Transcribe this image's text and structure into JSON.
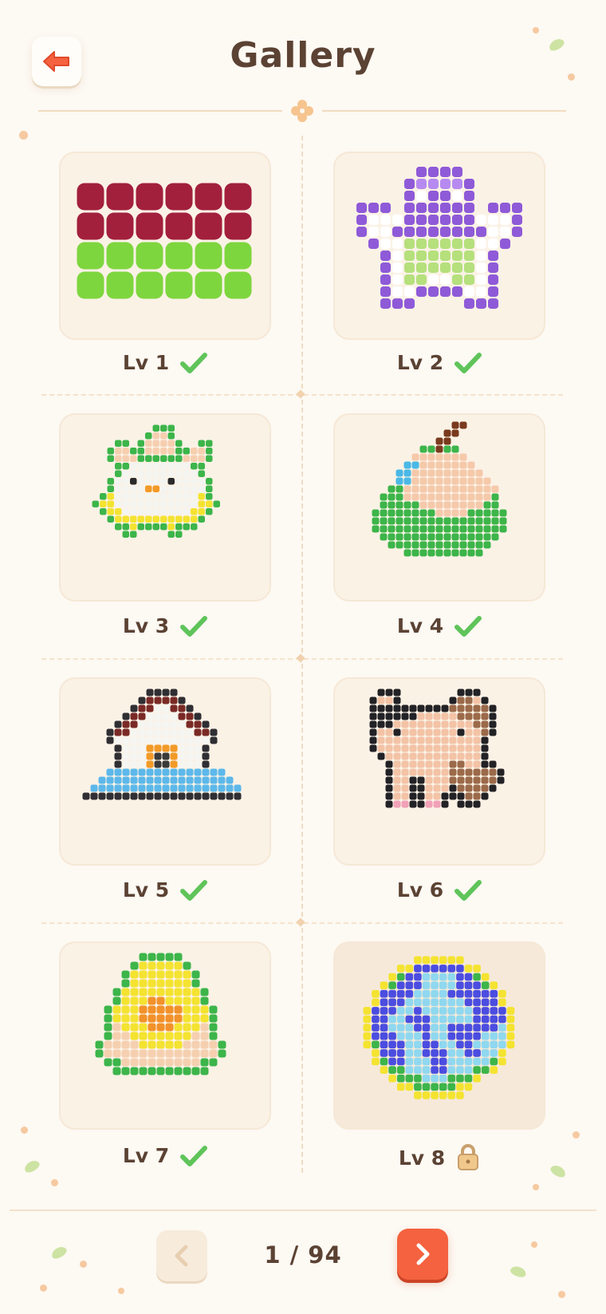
{
  "header": {
    "title": "Gallery"
  },
  "levels": [
    {
      "label": "Lv 1",
      "status": "completed"
    },
    {
      "label": "Lv 2",
      "status": "completed"
    },
    {
      "label": "Lv 3",
      "status": "completed"
    },
    {
      "label": "Lv 4",
      "status": "completed"
    },
    {
      "label": "Lv 5",
      "status": "completed"
    },
    {
      "label": "Lv 6",
      "status": "completed"
    },
    {
      "label": "Lv 7",
      "status": "completed"
    },
    {
      "label": "Lv 8",
      "status": "locked"
    }
  ],
  "pagination": {
    "text": "1 / 94"
  },
  "icons": {
    "back": "arrow-left-icon",
    "completed": "checkmark-icon",
    "locked": "padlock-icon",
    "prev": "chevron-left-icon",
    "next": "chevron-right-icon"
  },
  "colors": {
    "accent": "#f4623f",
    "title": "#5b4233",
    "check": "#5fc45a"
  }
}
